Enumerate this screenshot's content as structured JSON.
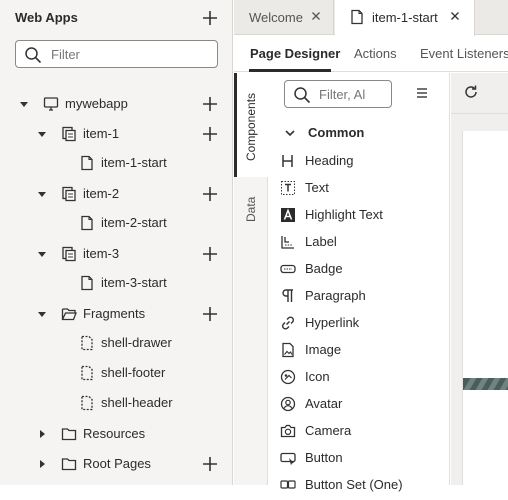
{
  "navigator": {
    "title": "Web Apps",
    "filter_placeholder": "Filter",
    "tree": [
      {
        "label": "mywebapp",
        "icon": "desktop-icon",
        "expanded": true,
        "addable": true
      },
      {
        "label": "item-1",
        "icon": "flow-icon",
        "expanded": true,
        "addable": true
      },
      {
        "label": "item-1-start",
        "icon": "page-icon"
      },
      {
        "label": "item-2",
        "icon": "flow-icon",
        "expanded": true,
        "addable": true
      },
      {
        "label": "item-2-start",
        "icon": "page-icon"
      },
      {
        "label": "item-3",
        "icon": "flow-icon",
        "expanded": true,
        "addable": true
      },
      {
        "label": "item-3-start",
        "icon": "page-icon"
      },
      {
        "label": "Fragments",
        "icon": "folder-open-icon",
        "expanded": true,
        "addable": true
      },
      {
        "label": "shell-drawer",
        "icon": "fragment-icon"
      },
      {
        "label": "shell-footer",
        "icon": "fragment-icon"
      },
      {
        "label": "shell-header",
        "icon": "fragment-icon"
      },
      {
        "label": "Resources",
        "icon": "folder-icon",
        "expanded": false
      },
      {
        "label": "Root Pages",
        "icon": "folder-icon",
        "expanded": false,
        "addable": true
      }
    ]
  },
  "tabs": [
    {
      "label": "Welcome",
      "active": false
    },
    {
      "label": "item-1-start",
      "active": true
    }
  ],
  "designer_tabs": [
    "Page Designer",
    "Actions",
    "Event Listeners"
  ],
  "side_tabs": [
    "Components",
    "Data"
  ],
  "palette": {
    "filter_placeholder": "Filter, Al",
    "section": "Common",
    "components": [
      {
        "label": "Heading",
        "icon": "heading-icon"
      },
      {
        "label": "Text",
        "icon": "text-icon"
      },
      {
        "label": "Highlight Text",
        "icon": "highlight-text-icon"
      },
      {
        "label": "Label",
        "icon": "label-icon"
      },
      {
        "label": "Badge",
        "icon": "badge-icon"
      },
      {
        "label": "Paragraph",
        "icon": "paragraph-icon"
      },
      {
        "label": "Hyperlink",
        "icon": "hyperlink-icon"
      },
      {
        "label": "Image",
        "icon": "image-icon"
      },
      {
        "label": "Icon",
        "icon": "icon-icon"
      },
      {
        "label": "Avatar",
        "icon": "avatar-icon"
      },
      {
        "label": "Camera",
        "icon": "camera-icon"
      },
      {
        "label": "Button",
        "icon": "button-icon"
      },
      {
        "label": "Button Set (One)",
        "icon": "button-set-icon"
      }
    ]
  },
  "colors": {
    "panel_bg": "#f5f4f2",
    "text": "#2b2b2b",
    "border": "#d9d6d2",
    "active_underline": "#2b2b2b"
  }
}
